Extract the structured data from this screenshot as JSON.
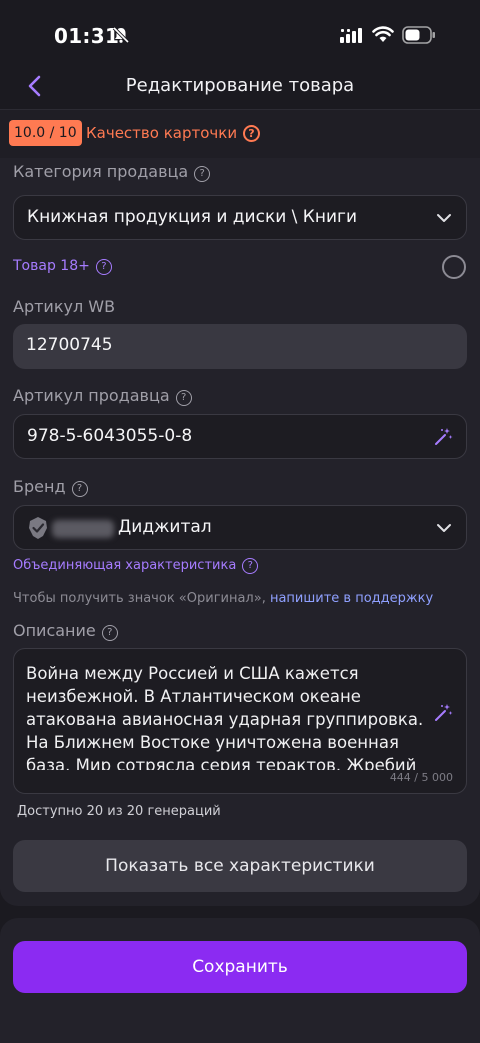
{
  "status_bar": {
    "time": "01:31"
  },
  "header": {
    "title": "Редактирование товара"
  },
  "quality": {
    "score": "10.0 / 10",
    "label": "Качество карточки"
  },
  "category": {
    "label": "Категория продавца",
    "value": "Книжная продукция и диски \\ Книги"
  },
  "adult": {
    "label": "Товар 18+"
  },
  "wb_article": {
    "label": "Артикул WB",
    "value": "12700745"
  },
  "seller_article": {
    "label": "Артикул продавца",
    "value": "978-5-6043055-0-8"
  },
  "brand": {
    "label": "Бренд",
    "value": "Диджитал"
  },
  "unifying": {
    "label": "Объединяющая характеристика"
  },
  "original_note": {
    "text": "Чтобы получить значок «Оригинал», ",
    "link": "напишите в поддержку"
  },
  "description": {
    "label": "Описание",
    "value": "Война между Россией и США кажется неизбежной. В Атлантическом океане атакована авианосная ударная группировка. На Ближнем Востоке уничтожена военная база. Мир сотрясла серия терактов. Жребий",
    "counter": "444 / 5 000"
  },
  "generations": {
    "text": "Доступно 20 из 20 генераций"
  },
  "buttons": {
    "show_all": "Показать все характеристики",
    "save": "Сохранить"
  },
  "colors": {
    "accent": "#8b2bf2",
    "quality": "#ff7a52",
    "link": "#a67cff"
  }
}
